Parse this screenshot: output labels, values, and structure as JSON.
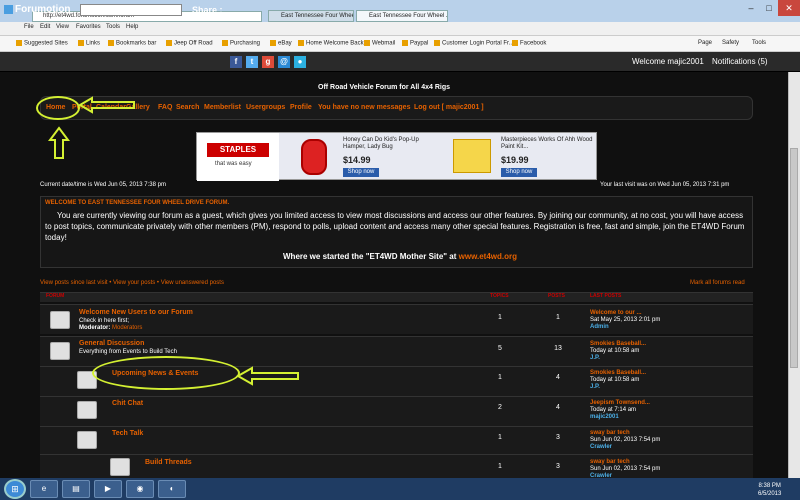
{
  "browser": {
    "address": "http://et4wd.forumotion.com/forum",
    "tabs": [
      "East Tennessee Four Wheel Dri...",
      "East Tennessee Four Wheel ..."
    ],
    "menu": [
      "File",
      "Edit",
      "View",
      "Favorites",
      "Tools",
      "Help"
    ],
    "favorites": [
      "Suggested Sites",
      "Links",
      "Bookmarks bar",
      "Jeep Off Road",
      "Purchasing",
      "eBay",
      "Home Welcome Back",
      "Webmail",
      "Paypal",
      "Customer Login Portal Fr...",
      "Facebook"
    ],
    "tools": [
      "Page",
      "Safety",
      "Tools"
    ]
  },
  "forumotion": {
    "brand": "Forumotion",
    "share_label": "Share :",
    "welcome": "Welcome majic2001",
    "notifications": "Notifications (5)"
  },
  "site": {
    "description": "Off Road Vehicle Forum for All 4x4 Rigs",
    "nav": [
      "Home",
      "Portal",
      "Calendar",
      "Gallery",
      "FAQ",
      "Search",
      "Memberlist",
      "Usergroups",
      "Profile",
      "You have no new messages",
      "Log out [ majic2001 ]"
    ],
    "current_date": "Current date/time is Wed Jun 05, 2013 7:38 pm",
    "last_visit": "Your last visit was on Wed Jun 05, 2013 7:31 pm"
  },
  "ads": {
    "staples_logo": "STAPLES",
    "staples_tag": "that was easy",
    "ad1_title": "Honey Can Do Kid's Pop-Up Hamper, Lady Bug",
    "ad1_price": "$14.99",
    "ad2_title": "Masterpieces Works Of Ahh Wood Paint Kit...",
    "ad2_price": "$19.99",
    "shop_now": "Shop now"
  },
  "welcome_box": {
    "heading": "WELCOME TO EAST TENNESSEE FOUR WHEEL DRIVE FORUM.",
    "text": "You are currently viewing our forum as a guest, which gives you limited access to view most discussions and access our other features. By joining our community, at no cost, you will have access to post topics, communicate privately with other members (PM), respond to polls, upload content and access many other special features. Registration is free, fast and simple, join the ET4WD Forum today!",
    "mother_site": "Where we started the \"ET4WD Mother Site\" at",
    "mother_link": "www.et4wd.org"
  },
  "links": {
    "quick": "View posts since last visit • View your posts • View unanswered posts",
    "mark_read": "Mark all forums read"
  },
  "table_headers": {
    "forum": "FORUM",
    "topics": "TOPICS",
    "posts": "POSTS",
    "last_posts": "LAST POSTS"
  },
  "forums": [
    {
      "title": "Welcome New Users to our Forum",
      "desc": "Check in here first;",
      "moderator_label": "Moderator:",
      "moderator": "Moderators",
      "topics": "1",
      "posts": "1",
      "last_title": "Welcome to our ...",
      "last_date": "Sat May 25, 2013 2:01 pm",
      "last_user": "Admin"
    },
    {
      "title": "General Discussion",
      "desc": "Everything from Events to Build Tech",
      "topics": "5",
      "posts": "13",
      "last_title": "Smokies Baseball...",
      "last_date": "Today at 10:58 am",
      "last_user": "J.P."
    },
    {
      "title": "Upcoming News & Events",
      "topics": "1",
      "posts": "4",
      "last_title": "Smokies Baseball...",
      "last_date": "Today at 10:58 am",
      "last_user": "J.P."
    },
    {
      "title": "Chit Chat",
      "topics": "2",
      "posts": "4",
      "last_title": "Jeepism Townsend...",
      "last_date": "Today at 7:14 am",
      "last_user": "majic2001"
    },
    {
      "title": "Tech Talk",
      "topics": "1",
      "posts": "3",
      "last_title": "sway bar tech",
      "last_date": "Sun Jun 02, 2013 7:54 pm",
      "last_user": "Crawler"
    },
    {
      "title": "Build Threads",
      "topics": "1",
      "posts": "3",
      "last_title": "sway bar tech",
      "last_date": "Sun Jun 02, 2013 7:54 pm",
      "last_user": "Crawler"
    }
  ],
  "taskbar": {
    "time": "8:38 PM",
    "date": "6/5/2013"
  },
  "colors": {
    "accent": "#e66100",
    "highlight": "#d4f032",
    "background": "#101010"
  }
}
